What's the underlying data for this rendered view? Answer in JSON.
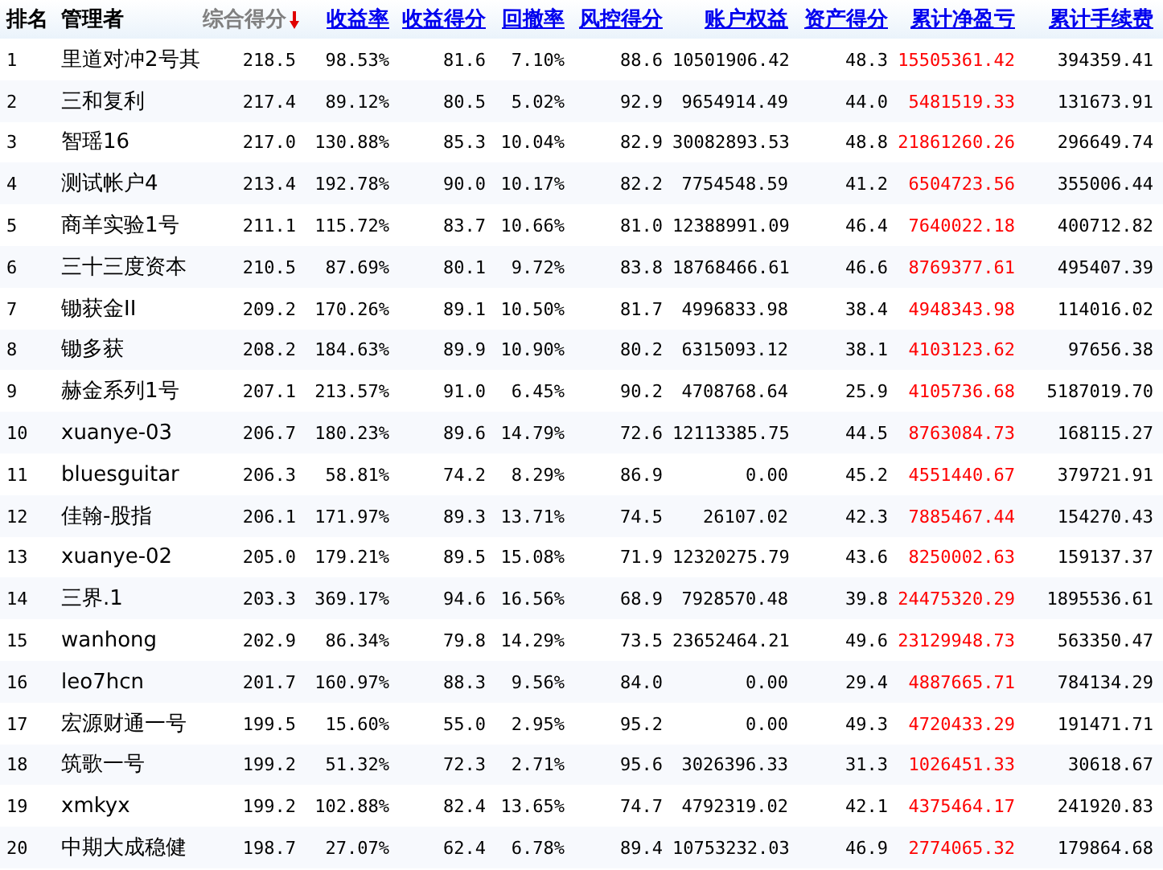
{
  "table": {
    "columns": [
      {
        "label": "排名",
        "kind": "plain",
        "red": false
      },
      {
        "label": "管理者",
        "kind": "plain",
        "red": false
      },
      {
        "label": "综合得分",
        "kind": "sorted",
        "red": false
      },
      {
        "label": "收益率",
        "kind": "link",
        "red": false
      },
      {
        "label": "收益得分",
        "kind": "link",
        "red": false
      },
      {
        "label": "回撤率",
        "kind": "link",
        "red": false
      },
      {
        "label": "风控得分",
        "kind": "link",
        "red": false
      },
      {
        "label": "账户权益",
        "kind": "link",
        "red": false
      },
      {
        "label": "资产得分",
        "kind": "link",
        "red": false
      },
      {
        "label": "累计净盈亏",
        "kind": "link",
        "red": true
      },
      {
        "label": "累计手续费",
        "kind": "link",
        "red": false
      }
    ],
    "rows": [
      [
        "1",
        "里道对冲2号其",
        "218.5",
        "98.53%",
        "81.6",
        "7.10%",
        "88.6",
        "10501906.42",
        "48.3",
        "15505361.42",
        "394359.41"
      ],
      [
        "2",
        "三和复利",
        "217.4",
        "89.12%",
        "80.5",
        "5.02%",
        "92.9",
        "9654914.49",
        "44.0",
        "5481519.33",
        "131673.91"
      ],
      [
        "3",
        "智瑶16",
        "217.0",
        "130.88%",
        "85.3",
        "10.04%",
        "82.9",
        "30082893.53",
        "48.8",
        "21861260.26",
        "296649.74"
      ],
      [
        "4",
        "测试帐户4",
        "213.4",
        "192.78%",
        "90.0",
        "10.17%",
        "82.2",
        "7754548.59",
        "41.2",
        "6504723.56",
        "355006.44"
      ],
      [
        "5",
        "商羊实验1号",
        "211.1",
        "115.72%",
        "83.7",
        "10.66%",
        "81.0",
        "12388991.09",
        "46.4",
        "7640022.18",
        "400712.82"
      ],
      [
        "6",
        "三十三度资本",
        "210.5",
        "87.69%",
        "80.1",
        "9.72%",
        "83.8",
        "18768466.61",
        "46.6",
        "8769377.61",
        "495407.39"
      ],
      [
        "7",
        "锄获金II",
        "209.2",
        "170.26%",
        "89.1",
        "10.50%",
        "81.7",
        "4996833.98",
        "38.4",
        "4948343.98",
        "114016.02"
      ],
      [
        "8",
        "锄多获",
        "208.2",
        "184.63%",
        "89.9",
        "10.90%",
        "80.2",
        "6315093.12",
        "38.1",
        "4103123.62",
        "97656.38"
      ],
      [
        "9",
        "赫金系列1号",
        "207.1",
        "213.57%",
        "91.0",
        "6.45%",
        "90.2",
        "4708768.64",
        "25.9",
        "4105736.68",
        "5187019.70"
      ],
      [
        "10",
        "xuanye-03",
        "206.7",
        "180.23%",
        "89.6",
        "14.79%",
        "72.6",
        "12113385.75",
        "44.5",
        "8763084.73",
        "168115.27"
      ],
      [
        "11",
        "bluesguitar",
        "206.3",
        "58.81%",
        "74.2",
        "8.29%",
        "86.9",
        "0.00",
        "45.2",
        "4551440.67",
        "379721.91"
      ],
      [
        "12",
        "佳翰-股指",
        "206.1",
        "171.97%",
        "89.3",
        "13.71%",
        "74.5",
        "26107.02",
        "42.3",
        "7885467.44",
        "154270.43"
      ],
      [
        "13",
        "xuanye-02",
        "205.0",
        "179.21%",
        "89.5",
        "15.08%",
        "71.9",
        "12320275.79",
        "43.6",
        "8250002.63",
        "159137.37"
      ],
      [
        "14",
        "三界.1",
        "203.3",
        "369.17%",
        "94.6",
        "16.56%",
        "68.9",
        "7928570.48",
        "39.8",
        "24475320.29",
        "1895536.61"
      ],
      [
        "15",
        "wanhong",
        "202.9",
        "86.34%",
        "79.8",
        "14.29%",
        "73.5",
        "23652464.21",
        "49.6",
        "23129948.73",
        "563350.47"
      ],
      [
        "16",
        "leo7hcn",
        "201.7",
        "160.97%",
        "88.3",
        "9.56%",
        "84.0",
        "0.00",
        "29.4",
        "4887665.71",
        "784134.29"
      ],
      [
        "17",
        "宏源财通一号",
        "199.5",
        "15.60%",
        "55.0",
        "2.95%",
        "95.2",
        "0.00",
        "49.3",
        "4720433.29",
        "191471.71"
      ],
      [
        "18",
        "筑歌一号",
        "199.2",
        "51.32%",
        "72.3",
        "2.71%",
        "95.6",
        "3026396.33",
        "31.3",
        "1026451.33",
        "30618.67"
      ],
      [
        "19",
        "xmkyx",
        "199.2",
        "102.88%",
        "82.4",
        "13.65%",
        "74.7",
        "4792319.02",
        "42.1",
        "4375464.17",
        "241920.83"
      ],
      [
        "20",
        "中期大成稳健",
        "198.7",
        "27.07%",
        "62.4",
        "6.78%",
        "89.4",
        "10753232.03",
        "46.9",
        "2774065.32",
        "179864.68"
      ]
    ]
  }
}
